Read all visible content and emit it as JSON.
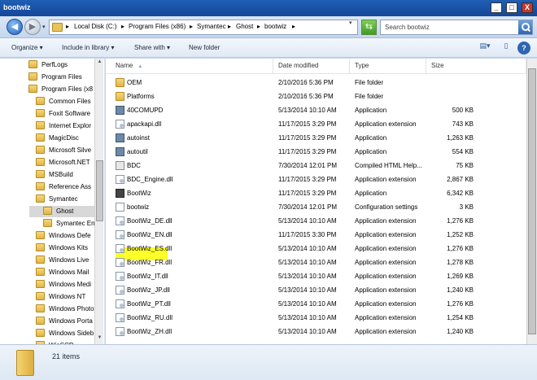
{
  "window": {
    "title": "bootwiz",
    "minimize_label": "_",
    "maximize_label": "□",
    "close_label": "X"
  },
  "address": {
    "back_label": "◀",
    "forward_label": "▶",
    "breadcrumbs": [
      "Local Disk (C:)",
      "Program Files (x86)",
      "Symantec",
      "Ghost",
      "bootwiz"
    ],
    "separator": "▸",
    "search_placeholder": "Search bootwiz"
  },
  "toolbar": {
    "organize_label": "Organize ▾",
    "include_label": "Include in library ▾",
    "share_label": "Share with ▾",
    "new_folder_label": "New folder",
    "help_label": "?"
  },
  "nav_tree": [
    {
      "label": "PerfLogs",
      "indent": 0
    },
    {
      "label": "Program Files",
      "indent": 0
    },
    {
      "label": "Program Files (x8",
      "indent": 0
    },
    {
      "label": "Common Files",
      "indent": 1
    },
    {
      "label": "Foxit Software",
      "indent": 1
    },
    {
      "label": "Internet Explor",
      "indent": 1
    },
    {
      "label": "MagicDisc",
      "indent": 1
    },
    {
      "label": "Microsoft Silve",
      "indent": 1
    },
    {
      "label": "Microsoft.NET",
      "indent": 1
    },
    {
      "label": "MSBuild",
      "indent": 1
    },
    {
      "label": "Reference Ass",
      "indent": 1
    },
    {
      "label": "Symantec",
      "indent": 1
    },
    {
      "label": "Ghost",
      "indent": 2,
      "selected": true
    },
    {
      "label": "Symantec En",
      "indent": 2
    },
    {
      "label": "Windows Defe",
      "indent": 1
    },
    {
      "label": "Windows Kits",
      "indent": 1
    },
    {
      "label": "Windows Live",
      "indent": 1
    },
    {
      "label": "Windows Mail",
      "indent": 1
    },
    {
      "label": "Windows Medi",
      "indent": 1
    },
    {
      "label": "Windows NT",
      "indent": 1
    },
    {
      "label": "Windows Photo",
      "indent": 1
    },
    {
      "label": "Windows Porta",
      "indent": 1
    },
    {
      "label": "Windows Sideb",
      "indent": 1
    },
    {
      "label": "WinSCP",
      "indent": 1
    }
  ],
  "columns": {
    "name": "Name",
    "date": "Date modified",
    "type": "Type",
    "size": "Size"
  },
  "files": [
    {
      "name": "OEM",
      "date": "2/10/2016 5:36 PM",
      "type": "File folder",
      "size": "",
      "icon": "folder-icon"
    },
    {
      "name": "Platforms",
      "date": "2/10/2016 5:36 PM",
      "type": "File folder",
      "size": "",
      "icon": "folder-icon"
    },
    {
      "name": "40COMUPD",
      "date": "5/13/2014 10:10 AM",
      "type": "Application",
      "size": "500 KB",
      "icon": "app-icon"
    },
    {
      "name": "apackapi.dll",
      "date": "11/17/2015 3:29 PM",
      "type": "Application extension",
      "size": "743 KB",
      "icon": "dll-icon"
    },
    {
      "name": "autoinst",
      "date": "11/17/2015 3:29 PM",
      "type": "Application",
      "size": "1,263 KB",
      "icon": "app-icon"
    },
    {
      "name": "autoutil",
      "date": "11/17/2015 3:29 PM",
      "type": "Application",
      "size": "554 KB",
      "icon": "app-icon"
    },
    {
      "name": "BDC",
      "date": "7/30/2014 12:01 PM",
      "type": "Compiled HTML Help...",
      "size": "75 KB",
      "icon": "chm-icon"
    },
    {
      "name": "BDC_Engine.dll",
      "date": "11/17/2015 3:29 PM",
      "type": "Application extension",
      "size": "2,867 KB",
      "icon": "dll-icon"
    },
    {
      "name": "BootWiz",
      "date": "11/17/2015 3:29 PM",
      "type": "Application",
      "size": "6,342 KB",
      "icon": "bootwiz-icon",
      "highlighted": true
    },
    {
      "name": "bootwiz",
      "date": "7/30/2014 12:01 PM",
      "type": "Configuration settings",
      "size": "3 KB",
      "icon": "config-icon"
    },
    {
      "name": "BootWiz_DE.dll",
      "date": "5/13/2014 10:10 AM",
      "type": "Application extension",
      "size": "1,276 KB",
      "icon": "dll-icon"
    },
    {
      "name": "BootWiz_EN.dll",
      "date": "11/17/2015 3:30 PM",
      "type": "Application extension",
      "size": "1,252 KB",
      "icon": "dll-icon"
    },
    {
      "name": "BootWiz_ES.dll",
      "date": "5/13/2014 10:10 AM",
      "type": "Application extension",
      "size": "1,276 KB",
      "icon": "dll-icon"
    },
    {
      "name": "BootWiz_FR.dll",
      "date": "5/13/2014 10:10 AM",
      "type": "Application extension",
      "size": "1,278 KB",
      "icon": "dll-icon"
    },
    {
      "name": "BootWiz_IT.dll",
      "date": "5/13/2014 10:10 AM",
      "type": "Application extension",
      "size": "1,269 KB",
      "icon": "dll-icon"
    },
    {
      "name": "BootWiz_JP.dll",
      "date": "5/13/2014 10:10 AM",
      "type": "Application extension",
      "size": "1,240 KB",
      "icon": "dll-icon"
    },
    {
      "name": "BootWiz_PT.dll",
      "date": "5/13/2014 10:10 AM",
      "type": "Application extension",
      "size": "1,276 KB",
      "icon": "dll-icon"
    },
    {
      "name": "BootWiz_RU.dll",
      "date": "5/13/2014 10:10 AM",
      "type": "Application extension",
      "size": "1,254 KB",
      "icon": "dll-icon"
    },
    {
      "name": "BootWiz_ZH.dll",
      "date": "5/13/2014 10:10 AM",
      "type": "Application extension",
      "size": "1,240 KB",
      "icon": "dll-icon"
    }
  ],
  "status": {
    "item_count": "21 items"
  },
  "colors": {
    "highlight": "#ffff2a",
    "titlebar": "#1f5fb4"
  }
}
